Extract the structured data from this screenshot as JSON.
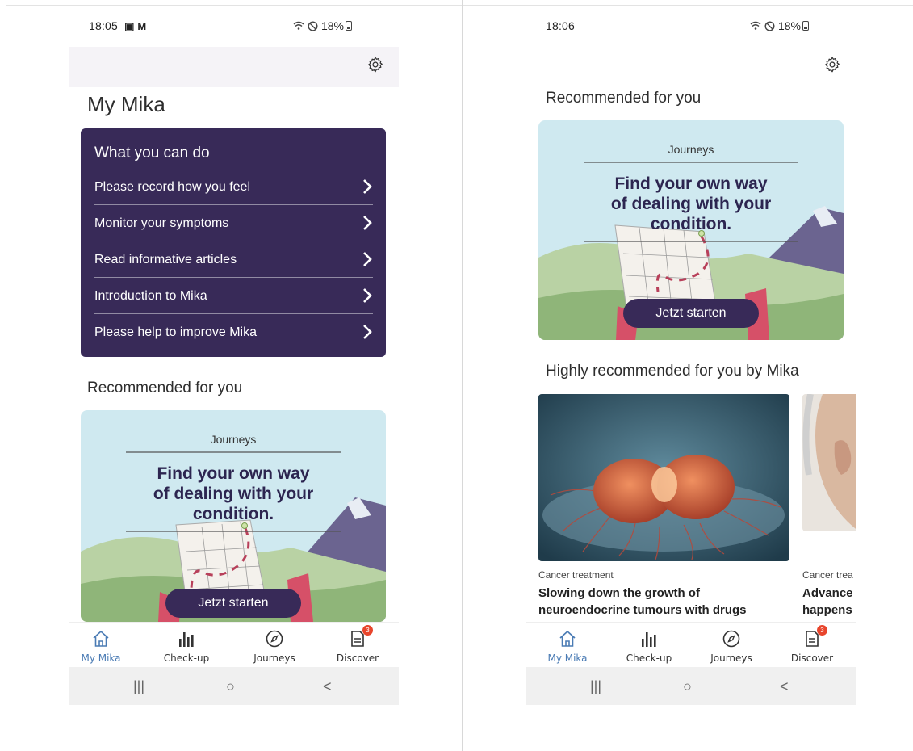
{
  "left": {
    "status": {
      "time": "18:05",
      "notif_icons": "▣ M",
      "right_text": "18%"
    },
    "title": "My Mika",
    "actions": {
      "heading": "What you can do",
      "items": [
        "Please record how you feel",
        "Monitor your symptoms",
        "Read informative articles",
        "Introduction to Mika",
        "Please help to improve Mika"
      ]
    },
    "recommended": {
      "heading": "Recommended for you",
      "card": {
        "tag": "Journeys",
        "headline_1": "Find your own way",
        "headline_2": "of dealing with your",
        "headline_3": "condition.",
        "cta": "Jetzt starten"
      }
    }
  },
  "right": {
    "status": {
      "time": "18:06",
      "right_text": "18%"
    },
    "recommended": {
      "heading": "Recommended for you",
      "card": {
        "tag": "Journeys",
        "headline_1": "Find your own way",
        "headline_2": "of dealing with your",
        "headline_3": "condition.",
        "cta": "Jetzt starten"
      }
    },
    "highly": {
      "heading": "Highly recommended for you by Mika",
      "articles": [
        {
          "category": "Cancer treatment",
          "title_1": "Slowing down the growth of",
          "title_2": "neuroendocrine tumours with drugs"
        },
        {
          "category": "Cancer trea",
          "title_1": "Advance",
          "title_2": "happens"
        }
      ]
    }
  },
  "nav": {
    "items": [
      "My Mika",
      "Check-up",
      "Journeys",
      "Discover"
    ],
    "badge": "3",
    "active": "My Mika",
    "active_color": "#4a7bb4"
  },
  "system_bar": {
    "recents": "|||",
    "home": "○",
    "back": "<"
  },
  "colors": {
    "card_purple": "#382a58",
    "promo_bg": "#cfe9f0",
    "badge_red": "#e8452c"
  }
}
